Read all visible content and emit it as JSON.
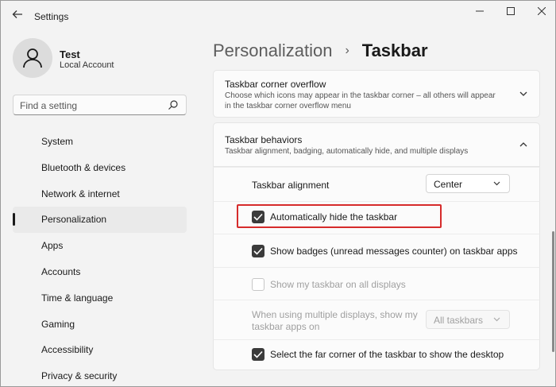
{
  "app": {
    "title": "Settings"
  },
  "user": {
    "name": "Test",
    "account_type": "Local Account"
  },
  "search": {
    "placeholder": "Find a setting"
  },
  "sidebar": {
    "items": [
      {
        "label": "System"
      },
      {
        "label": "Bluetooth & devices"
      },
      {
        "label": "Network & internet"
      },
      {
        "label": "Personalization",
        "active": true
      },
      {
        "label": "Apps"
      },
      {
        "label": "Accounts"
      },
      {
        "label": "Time & language"
      },
      {
        "label": "Gaming"
      },
      {
        "label": "Accessibility"
      },
      {
        "label": "Privacy & security"
      }
    ]
  },
  "breadcrumb": {
    "parent": "Personalization",
    "separator": "›",
    "current": "Taskbar"
  },
  "overflow_card": {
    "title": "Taskbar corner overflow",
    "description": "Choose which icons may appear in the taskbar corner – all others will appear in the taskbar corner overflow menu",
    "expanded": false
  },
  "behaviors_card": {
    "title": "Taskbar behaviors",
    "description": "Taskbar alignment, badging, automatically hide, and multiple displays",
    "expanded": true
  },
  "settings": {
    "alignment_label": "Taskbar alignment",
    "alignment_value": "Center",
    "auto_hide_label": "Automatically hide the taskbar",
    "auto_hide_checked": true,
    "badges_label": "Show badges (unread messages counter) on taskbar apps",
    "badges_checked": true,
    "all_displays_label": "Show my taskbar on all displays",
    "all_displays_checked": false,
    "multi_display_label": "When using multiple displays, show my taskbar apps on",
    "multi_display_value": "All taskbars",
    "far_corner_label": "Select the far corner of the taskbar to show the desktop",
    "far_corner_checked": true
  },
  "colors": {
    "highlight": "#d62b2b",
    "checkbox_fill": "#3b3b3b"
  }
}
